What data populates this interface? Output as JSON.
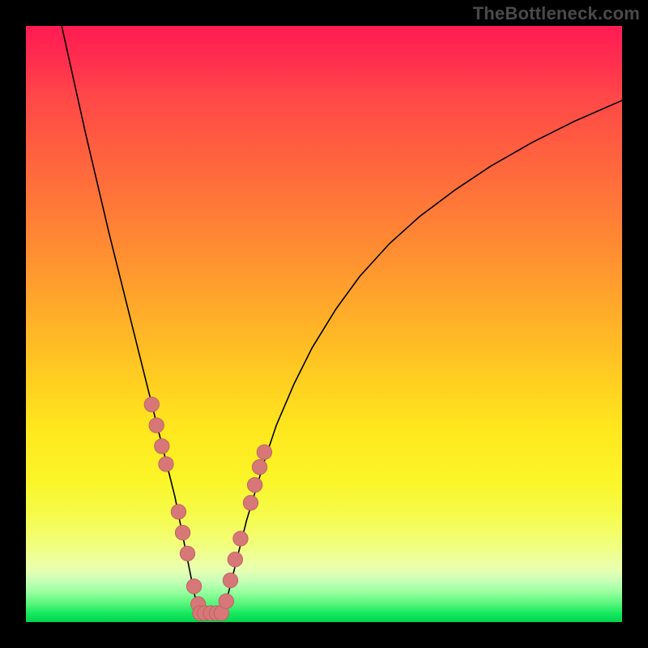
{
  "watermark": "TheBottleneck.com",
  "chart_data": {
    "type": "line",
    "title": "",
    "xlabel": "",
    "ylabel": "",
    "xlim": [
      0,
      100
    ],
    "ylim": [
      0,
      100
    ],
    "left_branch": {
      "x": [
        6,
        8,
        10,
        12,
        14,
        16,
        18,
        20,
        21,
        22,
        23,
        24,
        25,
        25.8,
        26.6,
        27.4,
        28.2,
        29
      ],
      "y": [
        100,
        91,
        82,
        73.5,
        65,
        57,
        49,
        41,
        37,
        33,
        29,
        25,
        21,
        17,
        13,
        9,
        5,
        1.5
      ]
    },
    "right_branch": {
      "x": [
        33,
        34,
        35,
        36,
        37,
        38.5,
        40,
        42,
        45,
        48,
        52,
        56,
        61,
        66,
        72,
        78,
        85,
        92,
        100
      ],
      "y": [
        1.5,
        5,
        9,
        13,
        17,
        22,
        27,
        33,
        40,
        46,
        52.5,
        58,
        63.5,
        68,
        72.5,
        76.5,
        80.5,
        84,
        87.5
      ]
    },
    "flat_valley": {
      "x": [
        29,
        33
      ],
      "y": [
        1.5,
        1.5
      ]
    },
    "markers_left": {
      "x": [
        21.1,
        21.9,
        22.8,
        23.5,
        25.6,
        26.3,
        27.1,
        28.2,
        28.9
      ],
      "y": [
        36.5,
        33,
        29.5,
        26.5,
        18.5,
        15,
        11.5,
        6,
        3
      ]
    },
    "markers_right": {
      "x": [
        33.6,
        34.3,
        35.1,
        36.0,
        37.7,
        38.4,
        39.2,
        40.0
      ],
      "y": [
        3.5,
        7,
        10.5,
        14,
        20,
        23,
        26,
        28.5
      ]
    },
    "markers_valley": {
      "x": [
        29.2,
        30.0,
        31.0,
        32.0,
        32.8
      ],
      "y": [
        1.5,
        1.5,
        1.5,
        1.5,
        1.5
      ]
    },
    "marker_color": "#d87777",
    "marker_stroke": "#b86262",
    "curve_color": "#000000"
  }
}
